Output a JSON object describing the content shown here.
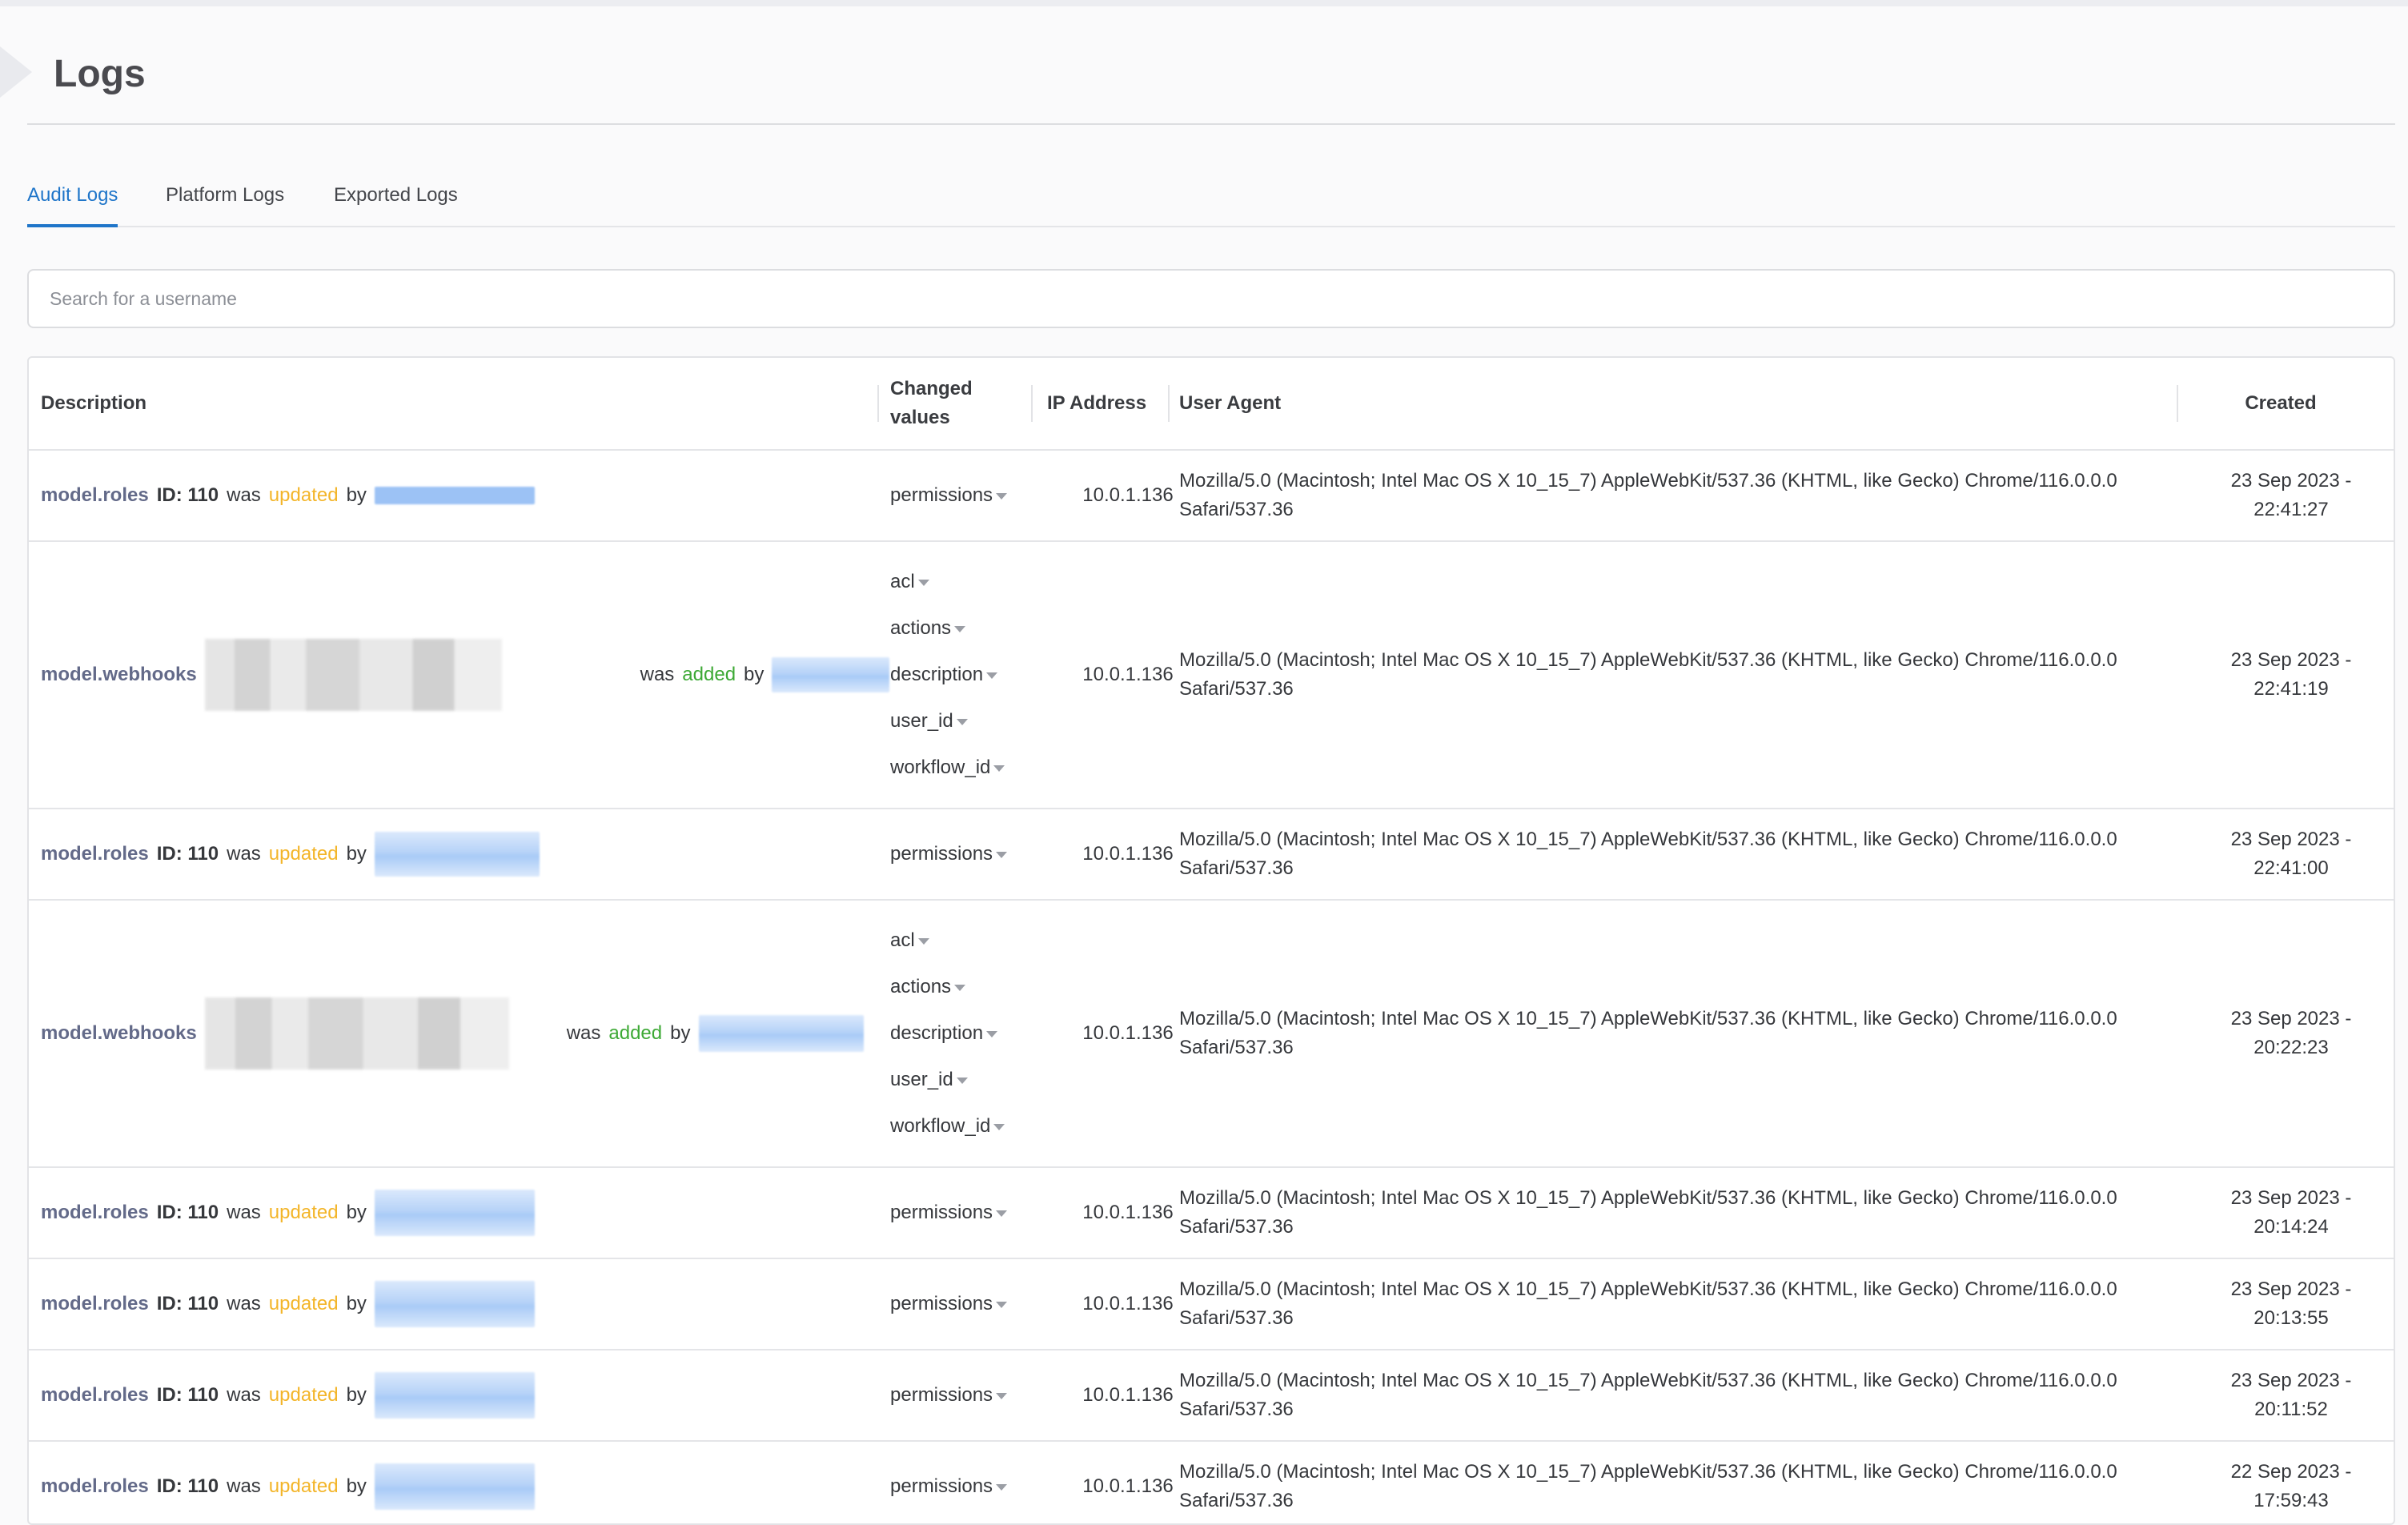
{
  "page": {
    "title": "Logs"
  },
  "tabs": [
    {
      "label": "Audit Logs",
      "active": true
    },
    {
      "label": "Platform Logs",
      "active": false
    },
    {
      "label": "Exported Logs",
      "active": false
    }
  ],
  "search": {
    "placeholder": "Search for a username",
    "value": ""
  },
  "table": {
    "columns": [
      "Description",
      "Changed values",
      "IP Address",
      "User Agent",
      "Created"
    ],
    "rows": [
      {
        "model": "model.roles",
        "id": "ID: 110",
        "was": "was",
        "action": "updated",
        "by": "by",
        "changed": [
          "permissions"
        ],
        "ip": "10.0.1.136",
        "ua": "Mozilla/5.0 (Macintosh; Intel Mac OS X 10_15_7) AppleWebKit/537.36 (KHTML, like Gecko) Chrome/116.0.0.0 Safari/537.36",
        "created_date": "23 Sep 2023 -",
        "created_time": "22:41:27"
      },
      {
        "model": "model.webhooks",
        "id": "",
        "was": "was",
        "action": "added",
        "by": "by",
        "changed": [
          "acl",
          "actions",
          "description",
          "user_id",
          "workflow_id"
        ],
        "ip": "10.0.1.136",
        "ua": "Mozilla/5.0 (Macintosh; Intel Mac OS X 10_15_7) AppleWebKit/537.36 (KHTML, like Gecko) Chrome/116.0.0.0 Safari/537.36",
        "created_date": "23 Sep 2023 -",
        "created_time": "22:41:19"
      },
      {
        "model": "model.roles",
        "id": "ID: 110",
        "was": "was",
        "action": "updated",
        "by": "by",
        "changed": [
          "permissions"
        ],
        "ip": "10.0.1.136",
        "ua": "Mozilla/5.0 (Macintosh; Intel Mac OS X 10_15_7) AppleWebKit/537.36 (KHTML, like Gecko) Chrome/116.0.0.0 Safari/537.36",
        "created_date": "23 Sep 2023 -",
        "created_time": "22:41:00"
      },
      {
        "model": "model.webhooks",
        "id": "",
        "was": "was",
        "action": "added",
        "by": "by",
        "changed": [
          "acl",
          "actions",
          "description",
          "user_id",
          "workflow_id"
        ],
        "ip": "10.0.1.136",
        "ua": "Mozilla/5.0 (Macintosh; Intel Mac OS X 10_15_7) AppleWebKit/537.36 (KHTML, like Gecko) Chrome/116.0.0.0 Safari/537.36",
        "created_date": "23 Sep 2023 -",
        "created_time": "20:22:23"
      },
      {
        "model": "model.roles",
        "id": "ID: 110",
        "was": "was",
        "action": "updated",
        "by": "by",
        "changed": [
          "permissions"
        ],
        "ip": "10.0.1.136",
        "ua": "Mozilla/5.0 (Macintosh; Intel Mac OS X 10_15_7) AppleWebKit/537.36 (KHTML, like Gecko) Chrome/116.0.0.0 Safari/537.36",
        "created_date": "23 Sep 2023 -",
        "created_time": "20:14:24"
      },
      {
        "model": "model.roles",
        "id": "ID: 110",
        "was": "was",
        "action": "updated",
        "by": "by",
        "changed": [
          "permissions"
        ],
        "ip": "10.0.1.136",
        "ua": "Mozilla/5.0 (Macintosh; Intel Mac OS X 10_15_7) AppleWebKit/537.36 (KHTML, like Gecko) Chrome/116.0.0.0 Safari/537.36",
        "created_date": "23 Sep 2023 -",
        "created_time": "20:13:55"
      },
      {
        "model": "model.roles",
        "id": "ID: 110",
        "was": "was",
        "action": "updated",
        "by": "by",
        "changed": [
          "permissions"
        ],
        "ip": "10.0.1.136",
        "ua": "Mozilla/5.0 (Macintosh; Intel Mac OS X 10_15_7) AppleWebKit/537.36 (KHTML, like Gecko) Chrome/116.0.0.0 Safari/537.36",
        "created_date": "23 Sep 2023 -",
        "created_time": "20:11:52"
      },
      {
        "model": "model.roles",
        "id": "ID: 110",
        "was": "was",
        "action": "updated",
        "by": "by",
        "changed": [
          "permissions"
        ],
        "ip": "10.0.1.136",
        "ua": "Mozilla/5.0 (Macintosh; Intel Mac OS X 10_15_7) AppleWebKit/537.36 (KHTML, like Gecko) Chrome/116.0.0.0 Safari/537.36",
        "created_date": "22 Sep 2023 -",
        "created_time": "17:59:43"
      }
    ]
  },
  "colors": {
    "accent": "#1f75c9",
    "updated": "#f3b529",
    "added": "#3da935",
    "model": "#636a89"
  }
}
